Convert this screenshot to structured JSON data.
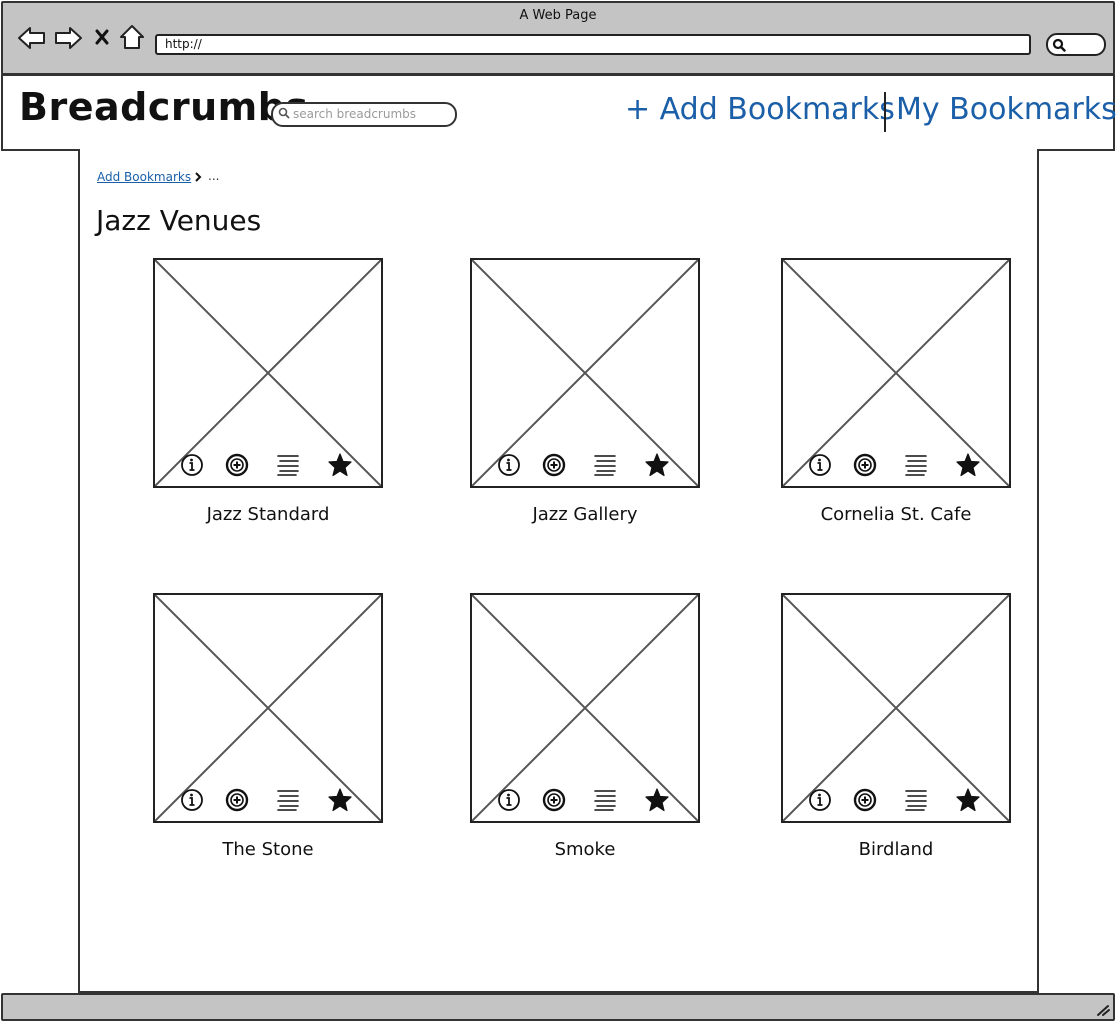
{
  "window": {
    "title": "A Web Page",
    "url": "http://"
  },
  "header": {
    "brand": "Breadcrumbs",
    "search_placeholder": "search breadcrumbs",
    "add_bookmarks": "+ Add Bookmarks",
    "my_bookmarks": "My Bookmarks"
  },
  "breadcrumb": {
    "link": "Add Bookmarks",
    "ellipsis": "..."
  },
  "page": {
    "title": "Jazz Venues"
  },
  "venues": [
    {
      "name": "Jazz Standard"
    },
    {
      "name": "Jazz Gallery"
    },
    {
      "name": "Cornelia St. Cafe"
    },
    {
      "name": "The Stone"
    },
    {
      "name": "Smoke"
    },
    {
      "name": "Birdland"
    }
  ],
  "card_icons": [
    "info-icon",
    "add-circle-icon",
    "list-icon",
    "star-icon"
  ],
  "colors": {
    "link": "#1a5fa8",
    "chrome": "#c4c4c4"
  }
}
